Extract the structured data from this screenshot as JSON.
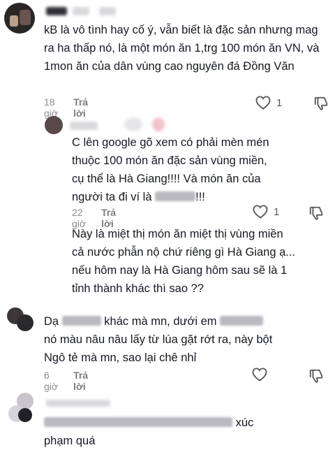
{
  "comments": [
    {
      "text": "kB là vô tình hay cố ý, vẫn biết là đặc sản nhưng mag ra ha thấp nó, là một món ăn 1,trg 100 món ăn VN, và 1mon ăn của dân vùng cao nguyên đá Đồng Văn",
      "time": "18 giờ",
      "reply_label": "Trả lời",
      "likes": "1"
    },
    {
      "text_line1": "C lên google gõ xem có phải mèn mén",
      "text_line2": "thuộc 100 món ăn đặc sản vùng miền,",
      "text_line3": "cụ thể là Hà Giang!!!! Và món ăn của",
      "text_line4_a": "người ta đi ví là",
      "text_line4_b": "!!!",
      "time": "22 giờ",
      "reply_label": "Trả lời",
      "likes": "1"
    },
    {
      "text": "Này là miệt thị món ăn miệt thị vùng miền cả nước phẫn nộ chứ riêng gì Hà Giang ạ... nếu hôm nay là Hà Giang hôm sau sẽ là 1 tỉnh thành khác thì sao ??"
    },
    {
      "text_line1_a": "Dạ",
      "text_line1_b": "khác mà mn, dưới em",
      "text_line2": "nó màu nâu nâu lấy từ lúa gặt rớt ra, này bột",
      "text_line3": "Ngô tẻ mà mn, sao lại chê nhỉ",
      "time": "6 giờ",
      "reply_label": "Trả lời"
    },
    {
      "text_line1_tail": "xúc",
      "text_line2": "phạm quá"
    }
  ],
  "icons": [
    "heart-outline-icon",
    "thumbs-down-icon"
  ],
  "colors": {
    "text": "#161823",
    "meta": "#8a8b91",
    "icon": "#545559"
  }
}
